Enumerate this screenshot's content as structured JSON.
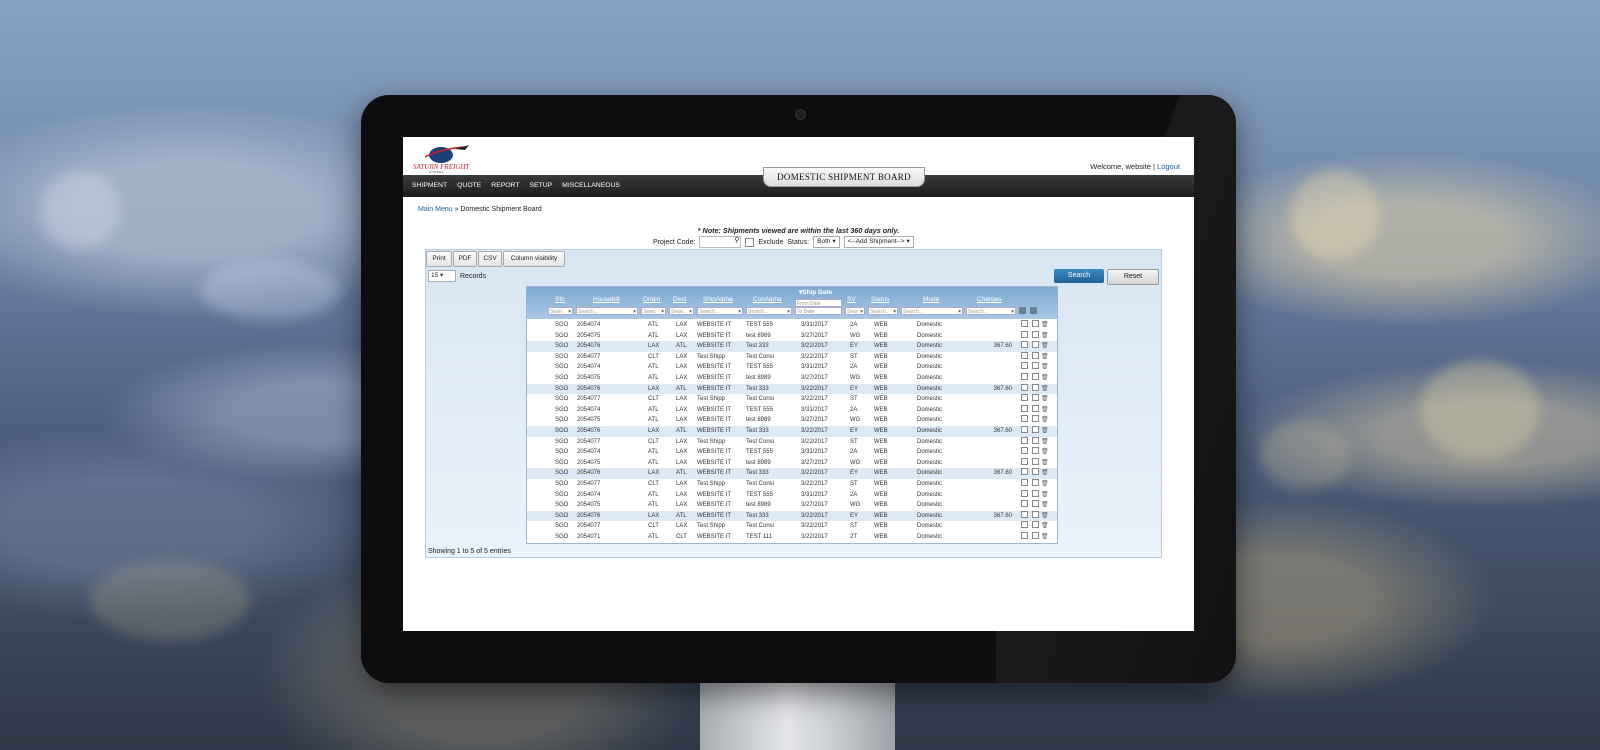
{
  "app": {
    "logo_text": "SATURN FREIGHT",
    "logo_sub": "SYSTEMS",
    "welcome_text": "Welcome, website |",
    "logout_label": "Logout",
    "board_title": "DOMESTIC SHIPMENT BOARD"
  },
  "nav": {
    "items": [
      {
        "label": "SHIPMENT"
      },
      {
        "label": "QUOTE"
      },
      {
        "label": "REPORT"
      },
      {
        "label": "SETUP"
      },
      {
        "label": "MISCELLANEOUS"
      }
    ]
  },
  "breadcrumb": {
    "main": "Main Menu",
    "sep": " » ",
    "current": "Domestic Shipment Board"
  },
  "note": "* Note: Shipments viewed are within the last 360 days only.",
  "filters": {
    "project_code_label": "Project Code:",
    "exclude_label": "Exclude",
    "status_label": "Status:",
    "status_value": "Both",
    "add_shipment_value": "<--Add Shipment-->"
  },
  "toolbar": {
    "print": "Print",
    "pdf": "PDF",
    "csv": "CSV",
    "column_visibility": "Column visibility"
  },
  "records": {
    "count": "15",
    "label": "Records"
  },
  "actions": {
    "search": "Search",
    "reset": "Reset"
  },
  "table": {
    "ship_date_header": "▾Ship Date",
    "columns": [
      "Stn",
      "Housebill",
      "Origin",
      "Dest",
      "ShipAlpha",
      "ConAlpha",
      "",
      "SV",
      "Status",
      "Mode",
      "Charges"
    ],
    "placeholders": {
      "stn": "Searc",
      "housebill": "Search...",
      "origin": "Searc",
      "dest": "Searc",
      "shipalpha": "Search...",
      "conalpha": "Search...",
      "from_date": "From Date",
      "to_date": "To Date",
      "sv": "Sear",
      "status": "Search..",
      "mode": "Search...",
      "charges": "Search..."
    },
    "rows": [
      {
        "stn": "SGO",
        "hb": "2054074",
        "orig": "ATL",
        "dest": "LAX",
        "ship": "WEBSITE IT",
        "con": "TEST 555",
        "date": "3/31/2017",
        "sv": "2A",
        "status": "WEB",
        "mode": "Domestic",
        "charges": ""
      },
      {
        "stn": "SGO",
        "hb": "2054075",
        "orig": "ATL",
        "dest": "LAX",
        "ship": "WEBSITE IT",
        "con": "test 8989",
        "date": "3/27/2017",
        "sv": "WG",
        "status": "WEB",
        "mode": "Domestic",
        "charges": ""
      },
      {
        "stn": "SGO",
        "hb": "2054076",
        "orig": "LAX",
        "dest": "ATL",
        "ship": "WEBSITE IT",
        "con": "Test 333",
        "date": "3/22/2017",
        "sv": "EY",
        "status": "WEB",
        "mode": "Domestic",
        "charges": "367.60"
      },
      {
        "stn": "SGO",
        "hb": "2054077",
        "orig": "CLT",
        "dest": "LAX",
        "ship": "Test Shipp",
        "con": "Test Consi",
        "date": "3/22/2017",
        "sv": "ST",
        "status": "WEB",
        "mode": "Domestic",
        "charges": ""
      },
      {
        "stn": "SGO",
        "hb": "2054074",
        "orig": "ATL",
        "dest": "LAX",
        "ship": "WEBSITE IT",
        "con": "TEST 555",
        "date": "3/31/2017",
        "sv": "2A",
        "status": "WEB",
        "mode": "Domestic",
        "charges": ""
      },
      {
        "stn": "SGO",
        "hb": "2054075",
        "orig": "ATL",
        "dest": "LAX",
        "ship": "WEBSITE IT",
        "con": "test 8989",
        "date": "3/27/2017",
        "sv": "WG",
        "status": "WEB",
        "mode": "Domestic",
        "charges": ""
      },
      {
        "stn": "SGO",
        "hb": "2054076",
        "orig": "LAX",
        "dest": "ATL",
        "ship": "WEBSITE IT",
        "con": "Test 333",
        "date": "3/22/2017",
        "sv": "EY",
        "status": "WEB",
        "mode": "Domestic",
        "charges": "367.60"
      },
      {
        "stn": "SGO",
        "hb": "2054077",
        "orig": "CLT",
        "dest": "LAX",
        "ship": "Test Shipp",
        "con": "Test Consi",
        "date": "3/22/2017",
        "sv": "ST",
        "status": "WEB",
        "mode": "Domestic",
        "charges": ""
      },
      {
        "stn": "SGO",
        "hb": "2054074",
        "orig": "ATL",
        "dest": "LAX",
        "ship": "WEBSITE IT",
        "con": "TEST 555",
        "date": "3/31/2017",
        "sv": "2A",
        "status": "WEB",
        "mode": "Domestic",
        "charges": ""
      },
      {
        "stn": "SGO",
        "hb": "2054075",
        "orig": "ATL",
        "dest": "LAX",
        "ship": "WEBSITE IT",
        "con": "test 8989",
        "date": "3/27/2017",
        "sv": "WG",
        "status": "WEB",
        "mode": "Domestic",
        "charges": ""
      },
      {
        "stn": "SGO",
        "hb": "2054076",
        "orig": "LAX",
        "dest": "ATL",
        "ship": "WEBSITE IT",
        "con": "Test 333",
        "date": "3/22/2017",
        "sv": "EY",
        "status": "WEB",
        "mode": "Domestic",
        "charges": "367.60"
      },
      {
        "stn": "SGO",
        "hb": "2054077",
        "orig": "CLT",
        "dest": "LAX",
        "ship": "Test Shipp",
        "con": "Test Consi",
        "date": "3/22/2017",
        "sv": "ST",
        "status": "WEB",
        "mode": "Domestic",
        "charges": ""
      },
      {
        "stn": "SGO",
        "hb": "2054074",
        "orig": "ATL",
        "dest": "LAX",
        "ship": "WEBSITE IT",
        "con": "TEST 555",
        "date": "3/31/2017",
        "sv": "2A",
        "status": "WEB",
        "mode": "Domestic",
        "charges": ""
      },
      {
        "stn": "SGO",
        "hb": "2054075",
        "orig": "ATL",
        "dest": "LAX",
        "ship": "WEBSITE IT",
        "con": "test 8989",
        "date": "3/27/2017",
        "sv": "WG",
        "status": "WEB",
        "mode": "Domestic",
        "charges": ""
      },
      {
        "stn": "SGO",
        "hb": "2054076",
        "orig": "LAX",
        "dest": "ATL",
        "ship": "WEBSITE IT",
        "con": "Test 333",
        "date": "3/22/2017",
        "sv": "EY",
        "status": "WEB",
        "mode": "Domestic",
        "charges": "367.60"
      },
      {
        "stn": "SGO",
        "hb": "2054077",
        "orig": "CLT",
        "dest": "LAX",
        "ship": "Test Shipp",
        "con": "Test Consi",
        "date": "3/22/2017",
        "sv": "ST",
        "status": "WEB",
        "mode": "Domestic",
        "charges": ""
      },
      {
        "stn": "SGO",
        "hb": "2054074",
        "orig": "ATL",
        "dest": "LAX",
        "ship": "WEBSITE IT",
        "con": "TEST 555",
        "date": "3/31/2017",
        "sv": "2A",
        "status": "WEB",
        "mode": "Domestic",
        "charges": ""
      },
      {
        "stn": "SGO",
        "hb": "2054075",
        "orig": "ATL",
        "dest": "LAX",
        "ship": "WEBSITE IT",
        "con": "test 8989",
        "date": "3/27/2017",
        "sv": "WG",
        "status": "WEB",
        "mode": "Domestic",
        "charges": ""
      },
      {
        "stn": "SGO",
        "hb": "2054076",
        "orig": "LAX",
        "dest": "ATL",
        "ship": "WEBSITE IT",
        "con": "Test 333",
        "date": "3/22/2017",
        "sv": "EY",
        "status": "WEB",
        "mode": "Domestic",
        "charges": "367.60"
      },
      {
        "stn": "SGO",
        "hb": "2054077",
        "orig": "CLT",
        "dest": "LAX",
        "ship": "Test Shipp",
        "con": "Test Consi",
        "date": "3/22/2017",
        "sv": "ST",
        "status": "WEB",
        "mode": "Domestic",
        "charges": ""
      },
      {
        "stn": "SGO",
        "hb": "2054071",
        "orig": "ATL",
        "dest": "CLT",
        "ship": "WEBSITE IT",
        "con": "TEST 111",
        "date": "3/22/2017",
        "sv": "2T",
        "status": "WEB",
        "mode": "Domestic",
        "charges": ""
      }
    ]
  },
  "footer": {
    "showing": "Showing 1 to 5 of 5 entries"
  },
  "colors": {
    "accent": "#1f5f93",
    "header": "#7ea8cf",
    "alt_row": "#dde9f5",
    "nav": "#1e1e1e"
  },
  "icons": [
    "view-icon",
    "globe-icon",
    "edit-icon",
    "trash-icon",
    "print-icon",
    "search-icon"
  ]
}
